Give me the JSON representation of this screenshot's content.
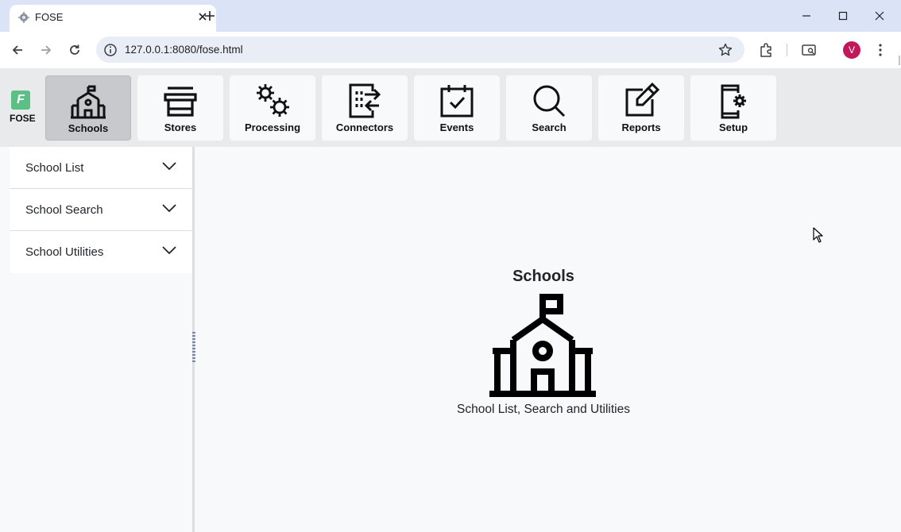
{
  "browser": {
    "tab_title": "FOSE",
    "url": "127.0.0.1:8080/fose.html",
    "avatar_letter": "V"
  },
  "app": {
    "brand": "FOSE",
    "brand_logo_letter": "F",
    "brand_color": "#5cbf86",
    "active_nav": "Schools",
    "nav": [
      {
        "label": "Schools",
        "icon": "school-icon"
      },
      {
        "label": "Stores",
        "icon": "store-icon"
      },
      {
        "label": "Processing",
        "icon": "gears-icon"
      },
      {
        "label": "Connectors",
        "icon": "connectors-icon"
      },
      {
        "label": "Events",
        "icon": "calendar-check-icon"
      },
      {
        "label": "Search",
        "icon": "search-icon"
      },
      {
        "label": "Reports",
        "icon": "edit-icon"
      },
      {
        "label": "Setup",
        "icon": "device-gear-icon"
      }
    ]
  },
  "sidebar": {
    "items": [
      {
        "label": "School List"
      },
      {
        "label": "School Search"
      },
      {
        "label": "School Utilities"
      }
    ]
  },
  "main": {
    "title": "Schools",
    "subtitle": "School List, Search and Utilities",
    "icon": "school-icon"
  }
}
